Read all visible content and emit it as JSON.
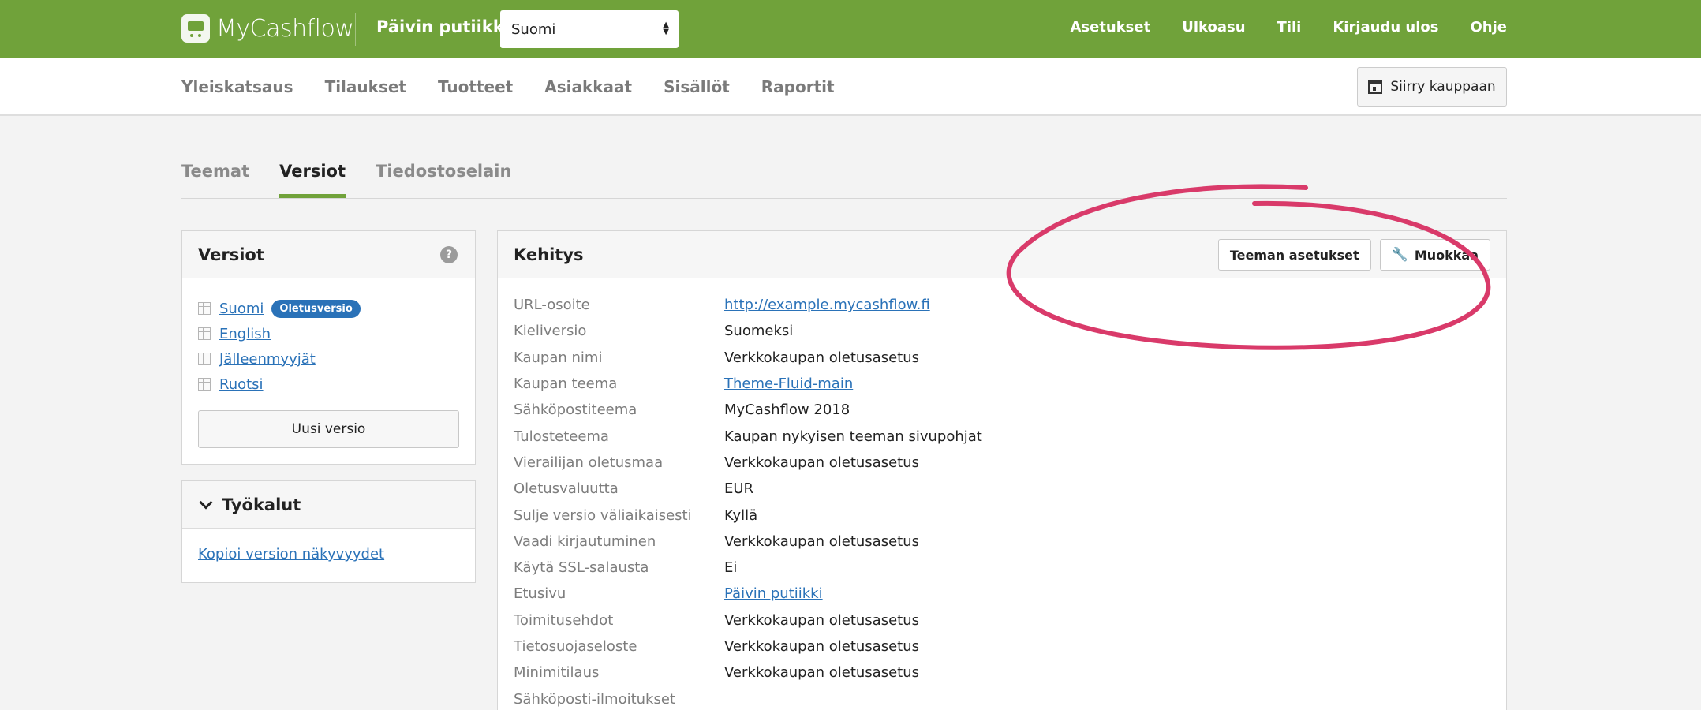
{
  "header": {
    "logo_text": "MyCashflow",
    "shop_name": "Päivin putiikki",
    "language_select": "Suomi",
    "nav": [
      "Asetukset",
      "Ulkoasu",
      "Tili",
      "Kirjaudu ulos",
      "Ohje"
    ]
  },
  "subnav": {
    "items": [
      "Yleiskatsaus",
      "Tilaukset",
      "Tuotteet",
      "Asiakkaat",
      "Sisällöt",
      "Raportit"
    ],
    "store_button": "Siirry kauppaan"
  },
  "tabs": [
    {
      "label": "Teemat",
      "active": false
    },
    {
      "label": "Versiot",
      "active": true
    },
    {
      "label": "Tiedostoselain",
      "active": false
    }
  ],
  "versions_panel": {
    "title": "Versiot",
    "help": "?",
    "items": [
      {
        "label": "Suomi",
        "badge": "Oletusversio"
      },
      {
        "label": "English"
      },
      {
        "label": "Jälleenmyyjät"
      },
      {
        "label": "Ruotsi"
      }
    ],
    "new_button": "Uusi versio"
  },
  "tools_panel": {
    "title": "Työkalut",
    "link": "Kopioi version näkyvyydet"
  },
  "main_panel": {
    "title": "Kehitys",
    "theme_settings_button": "Teeman asetukset",
    "edit_button": "Muokkaa",
    "rows": [
      {
        "label": "URL-osoite",
        "value": "http://example.mycashflow.fi",
        "link": true
      },
      {
        "label": "Kieliversio",
        "value": "Suomeksi"
      },
      {
        "label": "Kaupan nimi",
        "value": "Verkkokaupan oletusasetus"
      },
      {
        "label": "Kaupan teema",
        "value": "Theme-Fluid-main",
        "link": true
      },
      {
        "label": "Sähköpostiteema",
        "value": "MyCashflow 2018"
      },
      {
        "label": "Tulosteteema",
        "value": "Kaupan nykyisen teeman sivupohjat"
      },
      {
        "label": "Vierailijan oletusmaa",
        "value": "Verkkokaupan oletusasetus"
      },
      {
        "label": "Oletusvaluutta",
        "value": "EUR"
      },
      {
        "label": "Sulje versio väliaikaisesti",
        "value": "Kyllä"
      },
      {
        "label": "Vaadi kirjautuminen",
        "value": "Verkkokaupan oletusasetus"
      },
      {
        "label": "Käytä SSL-salausta",
        "value": "Ei"
      },
      {
        "label": "Etusivu",
        "value": "Päivin putiikki",
        "link": true
      },
      {
        "label": "Toimitusehdot",
        "value": "Verkkokaupan oletusasetus"
      },
      {
        "label": "Tietosuojaseloste",
        "value": "Verkkokaupan oletusasetus"
      },
      {
        "label": "Minimitilaus",
        "value": "Verkkokaupan oletusasetus"
      },
      {
        "label": "Sähköposti-ilmoitukset",
        "value": ""
      }
    ]
  },
  "colors": {
    "brand_green": "#70a23a",
    "link_blue": "#2a72b8",
    "annotation_pink": "#d93a6a"
  }
}
